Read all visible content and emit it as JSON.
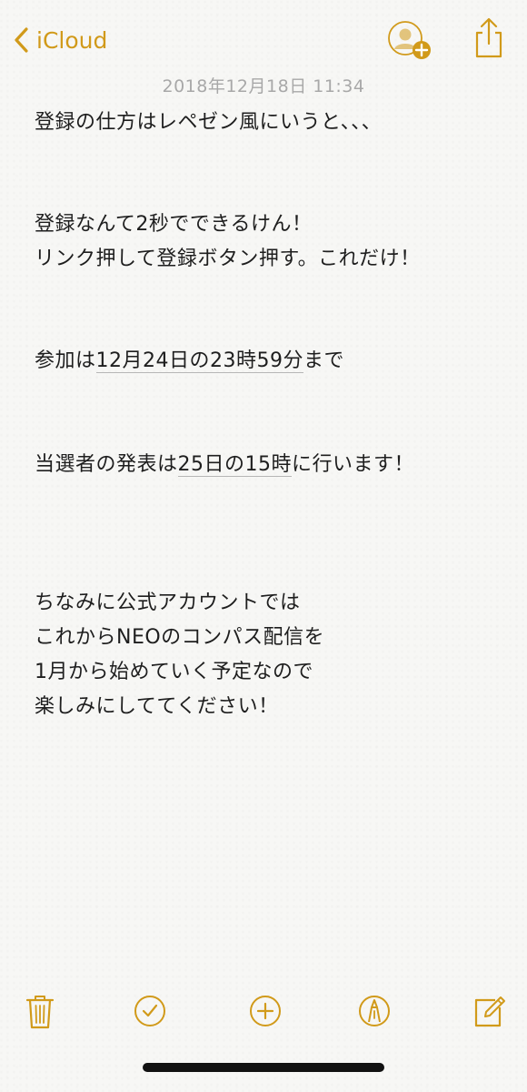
{
  "nav": {
    "back_label": "iCloud",
    "back_icon": "chevron-left-icon",
    "add_people_icon": "add-people-icon",
    "share_icon": "share-icon"
  },
  "note": {
    "timestamp": "2018年12月18日 11:34",
    "line1": "登録の仕方はレペゼン風にいうと、、、",
    "line2": "登録なんて2秒でできるけん！",
    "line3": "リンク押して登録ボタン押す。これだけ！",
    "line4_pre": "参加は",
    "line4_link": "12月24日の23時59分",
    "line4_post": "まで",
    "line5_pre": "当選者の発表は",
    "line5_link": "25日の15時",
    "line5_post": "に行います！",
    "line6": "ちなみに公式アカウントでは",
    "line7": "これからNEOのコンパス配信を",
    "line8": "1月から始めていく予定なので",
    "line9": "楽しみにしててください！"
  },
  "toolbar": {
    "icons": [
      "trash-icon",
      "checklist-icon",
      "add-icon",
      "markup-icon",
      "compose-icon"
    ]
  },
  "colors": {
    "accent": "#d19a1a",
    "background": "#f7f7f5",
    "text": "#1e1e1e",
    "timestamp": "#a8a8a8"
  }
}
